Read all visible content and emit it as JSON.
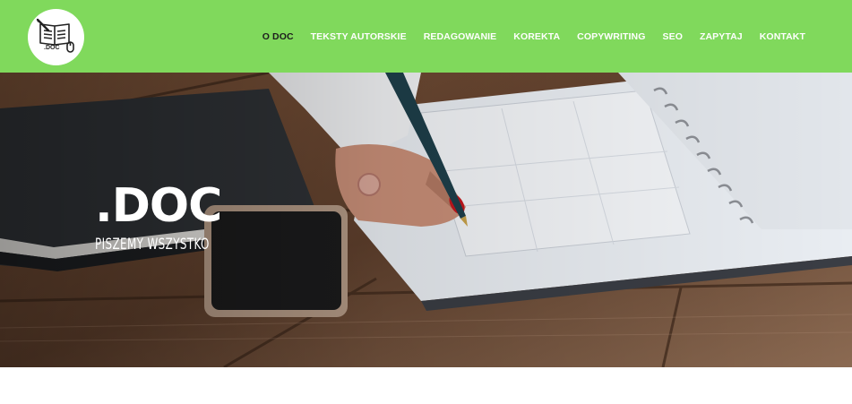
{
  "header": {
    "logo_icon": "book-document-logo-icon",
    "logo_text": ".DOC",
    "background_color": "#80d95c"
  },
  "nav": {
    "active_color": "#1d1d1d",
    "items": [
      {
        "label": "O DOC",
        "active": true
      },
      {
        "label": "TEKSTY AUTORSKIE",
        "active": false
      },
      {
        "label": "REDAGOWANIE",
        "active": false
      },
      {
        "label": "KOREKTA",
        "active": false
      },
      {
        "label": "COPYWRITING",
        "active": false
      },
      {
        "label": "SEO",
        "active": false
      },
      {
        "label": "ZAPYTAJ",
        "active": false
      },
      {
        "label": "KONTAKT",
        "active": false
      }
    ]
  },
  "hero": {
    "title": ".DOC",
    "subtitle": "PISZEMY WSZYSTKO"
  }
}
